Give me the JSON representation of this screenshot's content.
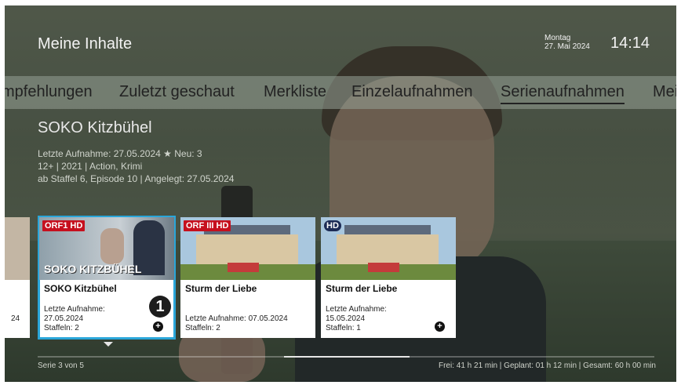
{
  "header": {
    "title": "Meine Inhalte",
    "day": "Montag",
    "date": "27. Mai 2024",
    "time": "14:14"
  },
  "tabs": [
    {
      "label": "mpfehlungen"
    },
    {
      "label": "Zuletzt geschaut"
    },
    {
      "label": "Merkliste"
    },
    {
      "label": "Einzelaufnahmen"
    },
    {
      "label": "Serienaufnahmen",
      "active": true
    },
    {
      "label": "Mei"
    }
  ],
  "selected_show": {
    "title": "SOKO Kitzbühel",
    "meta1_prefix": "Letzte Aufnahme: 27.05.2024",
    "meta1_new": "Neu: 3",
    "meta2": "12+  |  2021  |  Action, Krimi",
    "meta3": "ab Staffel 6, Episode 10  |  Angelegt: 27.05.2024"
  },
  "cards": [
    {
      "channel": "ORF1 HD",
      "title": "SOKO Kitzbühel",
      "image_text": "SOKO KITZBÜHEL",
      "line1": "Letzte Aufnahme:",
      "line2": "27.05.2024",
      "line3": "Staffeln: 2"
    },
    {
      "channel": "ORF III HD",
      "title": "Sturm der Liebe",
      "line1": "Letzte Aufnahme: 07.05.2024",
      "line2": "Staffeln: 2"
    },
    {
      "channel": "HD",
      "title": "Sturm der Liebe",
      "line1": "Letzte Aufnahme:",
      "line2": "15.05.2024",
      "line3": "Staffeln: 1"
    }
  ],
  "left_partial_card": {
    "line": "24"
  },
  "footer": {
    "counter": "Serie 3 von 5",
    "storage": "Frei: 41 h 21 min  |  Geplant: 01 h 12 min  |  Gesamt: 60 h 00 min"
  },
  "annotation": {
    "badge": "1"
  },
  "colors": {
    "focus": "#2aa6d9",
    "orf_red": "#c6101e"
  }
}
